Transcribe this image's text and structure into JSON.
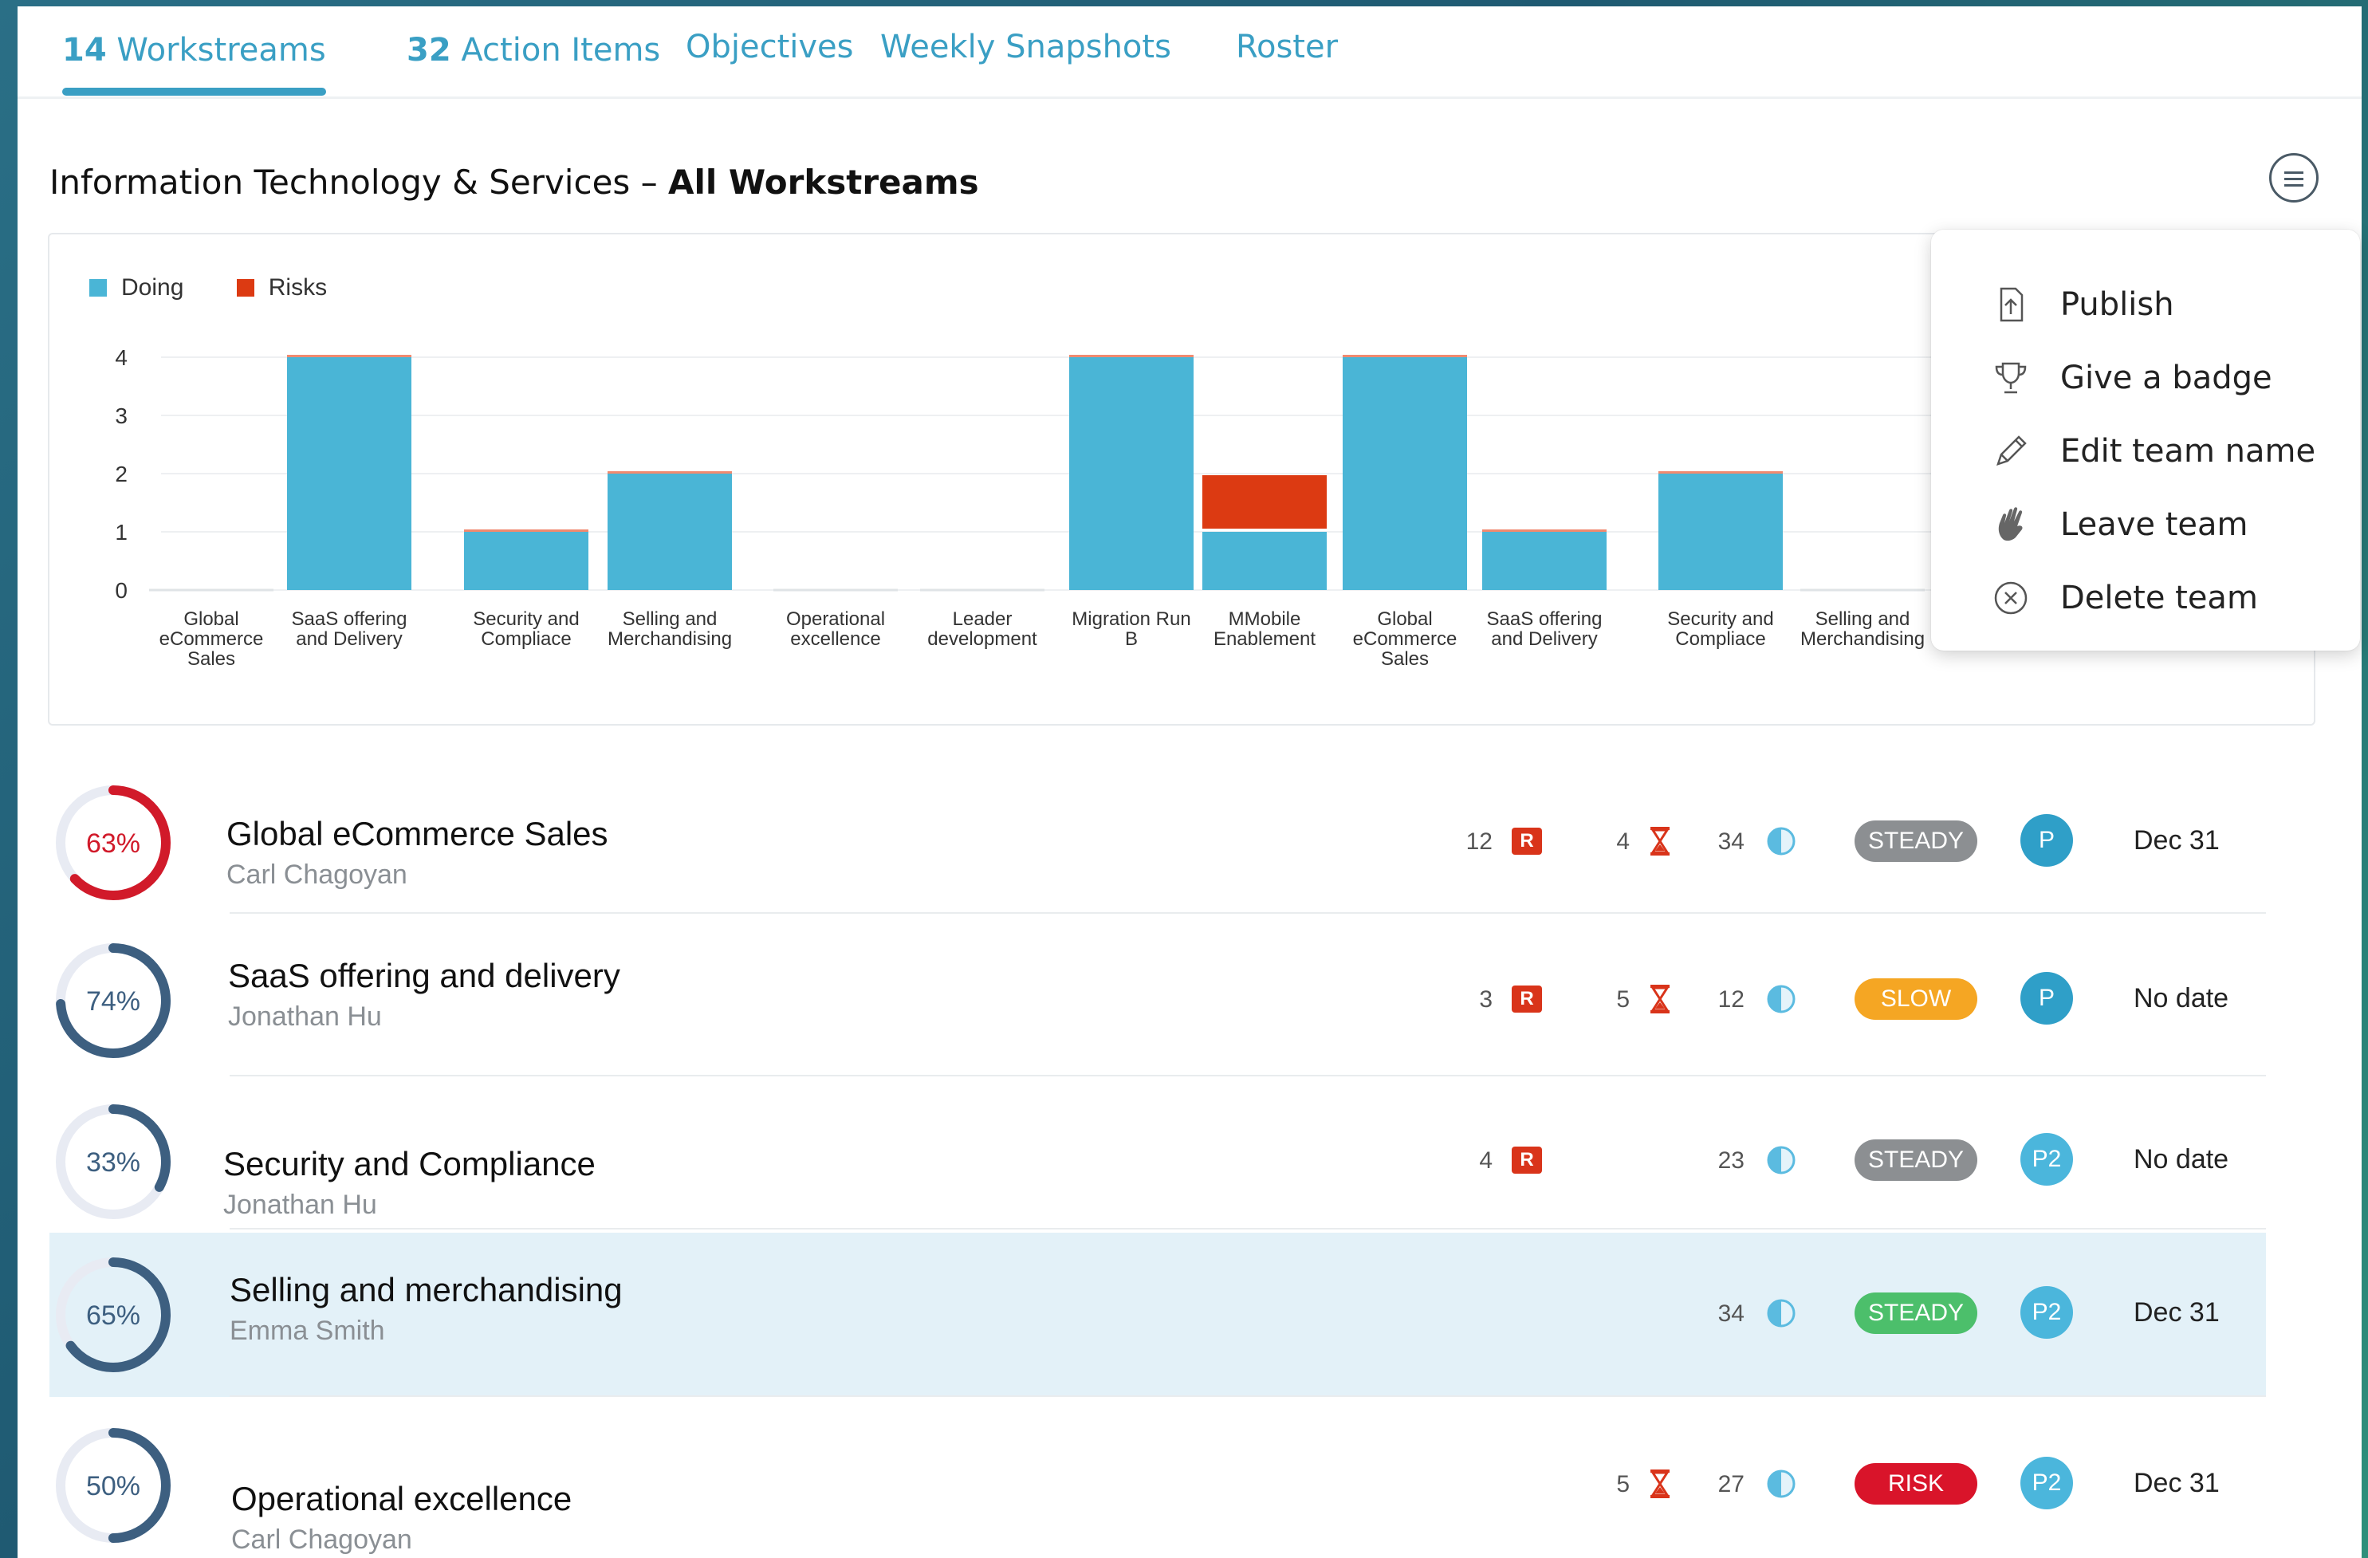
{
  "tabs": [
    {
      "count": "14",
      "label": "Workstreams"
    },
    {
      "count": "32",
      "label": "Action Items"
    },
    {
      "label": "Objectives"
    },
    {
      "label": "Weekly Snapshots"
    },
    {
      "label": "Roster"
    }
  ],
  "title": {
    "prefix": "Information Technology & Services – ",
    "bold": "All Workstreams"
  },
  "menu": {
    "items": [
      {
        "label": "Publish",
        "icon": "upload-icon"
      },
      {
        "label": "Give a badge",
        "icon": "trophy-icon"
      },
      {
        "label": "Edit team name",
        "icon": "pencil-icon"
      },
      {
        "label": "Leave team",
        "icon": "wave-hand-icon"
      },
      {
        "label": "Delete team",
        "icon": "close-circle-icon"
      }
    ]
  },
  "colors": {
    "accent": "#3a9fc4",
    "doing": "#4ab5d6",
    "risks": "#dc3a12",
    "steady": "#8c8f92",
    "slow": "#f5a623",
    "steady_green": "#4cbf6b",
    "risk": "#d9142a",
    "avatar": "#2f9fc8",
    "avatar2": "#4bb6dc"
  },
  "chart_data": {
    "type": "bar",
    "stacked": true,
    "legend": [
      {
        "name": "Doing",
        "color": "#4ab5d6"
      },
      {
        "name": "Risks",
        "color": "#dc3a12"
      }
    ],
    "categories": [
      "Global eCommerce Sales",
      "SaaS offering and Delivery",
      "Security and Compliace",
      "Selling and Merchandising",
      "Operational excellence",
      "Leader development",
      "Migration Run B",
      "MMobile Enablement",
      "Global eCommerce Sales",
      "SaaS offering and Delivery",
      "Security and Compliace",
      "Selling and Merchandising"
    ],
    "series": [
      {
        "name": "Doing",
        "values": [
          0,
          4,
          1,
          2,
          0,
          0,
          4,
          1,
          4,
          1,
          2,
          0
        ]
      },
      {
        "name": "Risks",
        "values": [
          0,
          0,
          0,
          0,
          0,
          0,
          0,
          1,
          0,
          0,
          0,
          0
        ]
      }
    ],
    "yticks": [
      "0",
      "1",
      "2",
      "3",
      "4"
    ],
    "ylim": [
      0,
      4
    ],
    "grid": true,
    "legend_position": "top-left"
  },
  "rows": [
    {
      "percent": "63%",
      "pct": 63,
      "ring_color": "#d11a2a",
      "title": "Global eCommerce Sales",
      "owner": "Carl Chagoyan",
      "r_count": "12",
      "hg_count": "4",
      "half_count": "34",
      "status": "STEADY",
      "status_color": "#8c8f92",
      "avatar": "P",
      "avatar_color": "#2f9fc8",
      "due": "Dec 31"
    },
    {
      "percent": "74%",
      "pct": 74,
      "ring_color": "#3d5f80",
      "title": "SaaS offering and delivery",
      "owner": "Jonathan Hu",
      "r_count": "3",
      "hg_count": "5",
      "half_count": "12",
      "status": "SLOW",
      "status_color": "#f5a623",
      "avatar": "P",
      "avatar_color": "#2f9fc8",
      "due": "No date"
    },
    {
      "percent": "33%",
      "pct": 33,
      "ring_color": "#3d5f80",
      "title": "Security and Compliance",
      "owner": "Jonathan Hu",
      "r_count": "4",
      "hg_count": "",
      "half_count": "23",
      "status": "STEADY",
      "status_color": "#8c8f92",
      "avatar": "P2",
      "avatar_color": "#4bb6dc",
      "due": "No date"
    },
    {
      "percent": "65%",
      "pct": 65,
      "ring_color": "#3d5f80",
      "title": "Selling and merchandising",
      "owner": "Emma Smith",
      "r_count": "",
      "hg_count": "",
      "half_count": "34",
      "status": "STEADY",
      "status_color": "#4cbf6b",
      "avatar": "P2",
      "avatar_color": "#4bb6dc",
      "due": "Dec 31"
    },
    {
      "percent": "50%",
      "pct": 50,
      "ring_color": "#3d5f80",
      "title": "Operational excellence",
      "owner": "Carl Chagoyan",
      "r_count": "",
      "hg_count": "5",
      "half_count": "27",
      "status": "RISK",
      "status_color": "#d9142a",
      "avatar": "P2",
      "avatar_color": "#4bb6dc",
      "due": "Dec 31"
    }
  ],
  "r_badge_label": "R"
}
